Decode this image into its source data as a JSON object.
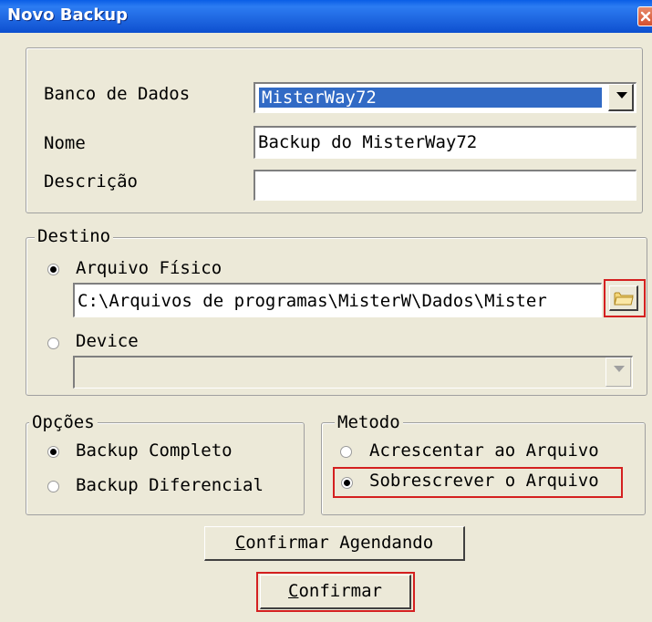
{
  "window": {
    "title": "Novo Backup"
  },
  "colors": {
    "highlight": "#d42020",
    "titlebar": "#1e66e0",
    "face": "#ece9d8",
    "selection": "#316ac5"
  },
  "top": {
    "banco_label": "Banco de Dados",
    "banco_value": "MisterWay72",
    "nome_label": "Nome",
    "nome_value": "Backup do MisterWay72",
    "descricao_label": "Descrição",
    "descricao_value": ""
  },
  "destino": {
    "legend": "Destino",
    "arquivo_label": "Arquivo Físico",
    "arquivo_path": "C:\\Arquivos de programas\\MisterW\\Dados\\Mister",
    "device_label": "Device",
    "device_value": "",
    "arquivo_checked": true,
    "device_checked": false,
    "browse_icon": "folder-icon"
  },
  "opcoes": {
    "legend": "Opções",
    "completo_label": "Backup Completo",
    "diferencial_label": "Backup Diferencial",
    "completo_checked": true,
    "diferencial_checked": false
  },
  "metodo": {
    "legend": "Metodo",
    "acrescentar_label": "Acrescentar ao Arquivo",
    "sobrescrever_label": "Sobrescrever o Arquivo",
    "acrescentar_checked": false,
    "sobrescrever_checked": true
  },
  "buttons": {
    "agendando_first": "C",
    "agendando_rest": "onfirmar Agendando",
    "confirmar_first": "C",
    "confirmar_rest": "onfirmar"
  }
}
